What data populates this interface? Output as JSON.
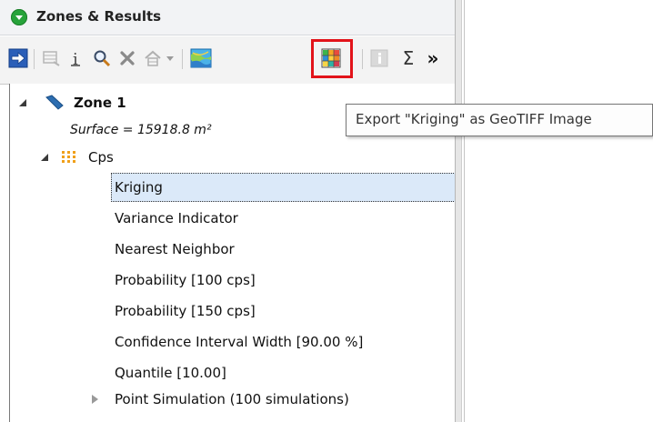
{
  "panel": {
    "title": "Zones & Results"
  },
  "colors": {
    "title_icon": "#27a33a",
    "highlight": "#e2131a",
    "selection": "#dbe9f9"
  },
  "toolbar": {
    "icons": [
      "export-arrow-icon",
      "disabled-table-icon",
      "info-i-icon",
      "magnifier-icon",
      "delete-x-icon",
      "disabled-house-icon",
      "dropdown-arrow-icon",
      "map-layer-icon",
      "grid-export-icon",
      "disabled-info-icon",
      "sigma-icon",
      "more-chevron-icon"
    ],
    "sigma": "Σ",
    "more": "»"
  },
  "tooltip": {
    "text": "Export \"Kriging\" as GeoTIFF Image"
  },
  "tree": {
    "zone_label": "Zone 1",
    "surface_text": "Surface = 15918.8 m²",
    "group_label": "Cps",
    "items": [
      "Kriging",
      "Variance Indicator",
      "Nearest Neighbor",
      "Probability [100 cps]",
      "Probability [150 cps]",
      "Confidence Interval Width [90.00 %]",
      "Quantile [10.00]"
    ],
    "collapsed_item": "Point Simulation (100 simulations)"
  }
}
